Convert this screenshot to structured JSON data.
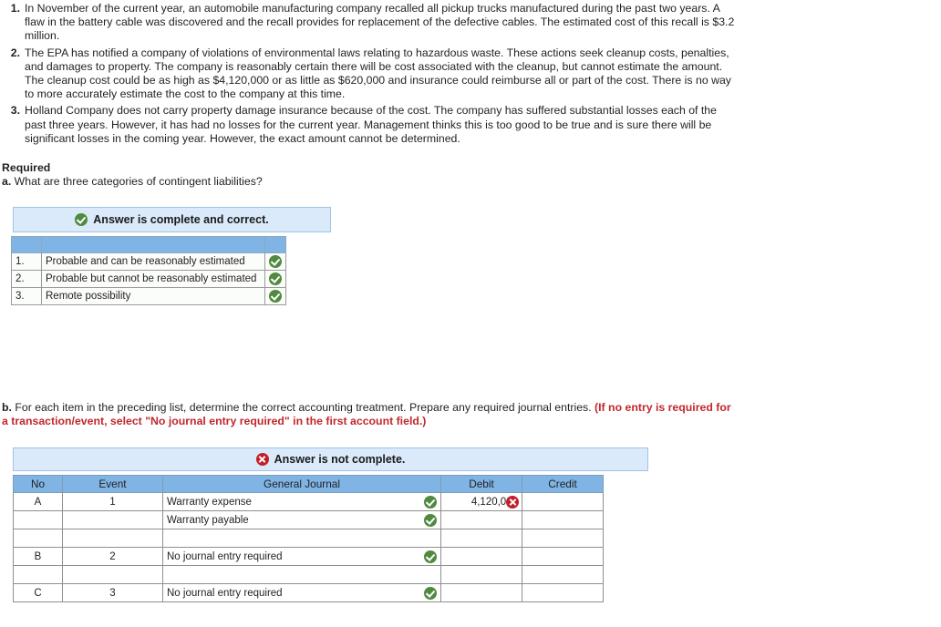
{
  "questions": [
    {
      "num": "1.",
      "text": "In November of the current year, an automobile manufacturing company recalled all pickup trucks manufactured during the past two years. A flaw in the battery cable was discovered and the recall provides for replacement of the defective cables. The estimated cost of this recall is $3.2 million."
    },
    {
      "num": "2.",
      "text": "The EPA has notified a company of violations of environmental laws relating to hazardous waste. These actions seek cleanup costs, penalties, and damages to property. The company is reasonably certain there will be cost associated with the cleanup, but cannot estimate the amount. The cleanup cost could be as high as $4,120,000 or as little as $620,000 and insurance could reimburse all or part of the cost. There is no way to more accurately estimate the cost to the company at this time."
    },
    {
      "num": "3.",
      "text": "Holland Company does not carry property damage insurance because of the cost. The company has suffered substantial losses each of the past three years. However, it has had no losses for the current year. Management thinks this is too good to be true and is sure there will be significant losses in the coming year. However, the exact amount cannot be determined."
    }
  ],
  "required": {
    "heading": "Required",
    "part_a_label": "a.",
    "part_a_text": " What are three categories of contingent liabilities?"
  },
  "part_a": {
    "banner": {
      "icon": "check-circle-icon",
      "text": "Answer is complete and correct."
    },
    "rows": [
      {
        "num": "1.",
        "answer": "Probable and can be reasonably estimated",
        "status_icon": "check-circle-icon"
      },
      {
        "num": "2.",
        "answer": "Probable but cannot be reasonably estimated",
        "status_icon": "check-circle-icon"
      },
      {
        "num": "3.",
        "answer": "Remote possibility",
        "status_icon": "check-circle-icon"
      }
    ]
  },
  "part_b": {
    "label": "b.",
    "text": " For each item in the preceding list, determine the correct accounting treatment. Prepare any required journal entries. ",
    "note": "(If no entry is required for a transaction/event, select \"No journal entry required\" in the first account field.)",
    "banner": {
      "icon": "x-circle-icon",
      "text": "Answer is not complete."
    },
    "columns": [
      "No",
      "Event",
      "General Journal",
      "Debit",
      "Credit"
    ],
    "rows": [
      {
        "no": "A",
        "event": "1",
        "account": "Warranty expense",
        "account_status": "check-circle-icon",
        "debit": "4,120,000",
        "debit_status": "x-circle-icon",
        "credit": ""
      },
      {
        "no": "",
        "event": "",
        "account": "Warranty payable",
        "account_status": "check-circle-icon",
        "debit": "",
        "debit_status": "",
        "credit": ""
      },
      {
        "no": "",
        "event": "",
        "account": "",
        "account_status": "",
        "debit": "",
        "debit_status": "",
        "credit": ""
      },
      {
        "no": "B",
        "event": "2",
        "account": "No journal entry required",
        "account_status": "check-circle-icon",
        "debit": "",
        "debit_status": "",
        "credit": ""
      },
      {
        "no": "",
        "event": "",
        "account": "",
        "account_status": "",
        "debit": "",
        "debit_status": "",
        "credit": ""
      },
      {
        "no": "C",
        "event": "3",
        "account": "No journal entry required",
        "account_status": "check-circle-icon",
        "debit": "",
        "debit_status": "",
        "credit": ""
      }
    ]
  },
  "colors": {
    "header_blue": "#7fb4e4",
    "banner_blue": "#dbeafa",
    "ok_green": "#4f8a3f",
    "error_red": "#c31f29",
    "note_red": "#c1272d"
  }
}
